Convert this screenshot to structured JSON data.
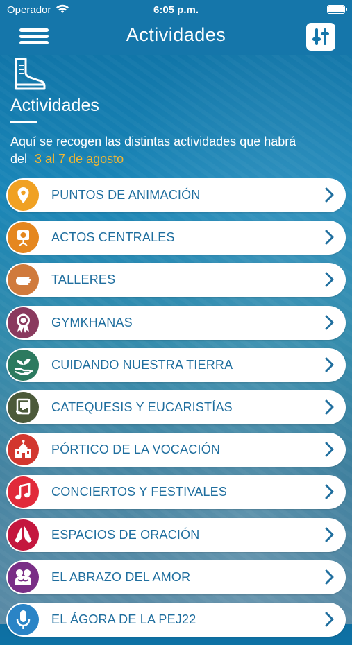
{
  "status_bar": {
    "carrier": "Operador",
    "time": "6:05 p.m."
  },
  "nav": {
    "title": "Actividades",
    "menu_icon": "hamburger-menu-icon",
    "filter_icon": "sliders-icon"
  },
  "header": {
    "icon": "boot-icon",
    "title": "Actividades",
    "intro_text": "Aquí se recogen las distintas actividades que habrá del",
    "intro_dates": "3 al 7 de agosto"
  },
  "colors": {
    "nav_bg": "#1576aa",
    "accent_dates": "#f2b632",
    "label_text": "#1f6e9e"
  },
  "items": [
    {
      "label": "PUNTOS DE ANIMACIÓN",
      "icon": "map-pin-icon",
      "color": "#f0a123"
    },
    {
      "label": "ACTOS CENTRALES",
      "icon": "stage-spotlight-icon",
      "color": "#e5871f"
    },
    {
      "label": "TALLERES",
      "icon": "hand-icon",
      "color": "#d07a3c"
    },
    {
      "label": "GYMKHANAS",
      "icon": "medal-icon",
      "color": "#8a3a5e"
    },
    {
      "label": "CUIDANDO NUESTRA TIERRA",
      "icon": "sprout-hand-icon",
      "color": "#2c7a5f"
    },
    {
      "label": "CATEQUESIS Y EUCARISTÍAS",
      "icon": "bible-hand-icon",
      "color": "#4c5a3a"
    },
    {
      "label": "PÓRTICO DE LA VOCACIÓN",
      "icon": "church-icon",
      "color": "#d2372f"
    },
    {
      "label": "CONCIERTOS Y FESTIVALES",
      "icon": "music-note-icon",
      "color": "#e12a3a"
    },
    {
      "label": "ESPACIOS DE ORACIÓN",
      "icon": "praying-hands-icon",
      "color": "#c4173e"
    },
    {
      "label": "EL ABRAZO DEL AMOR",
      "icon": "hug-icon",
      "color": "#7a2e86"
    },
    {
      "label": "EL ÁGORA DE LA PEJ22",
      "icon": "microphone-icon",
      "color": "#2a84c6"
    }
  ]
}
